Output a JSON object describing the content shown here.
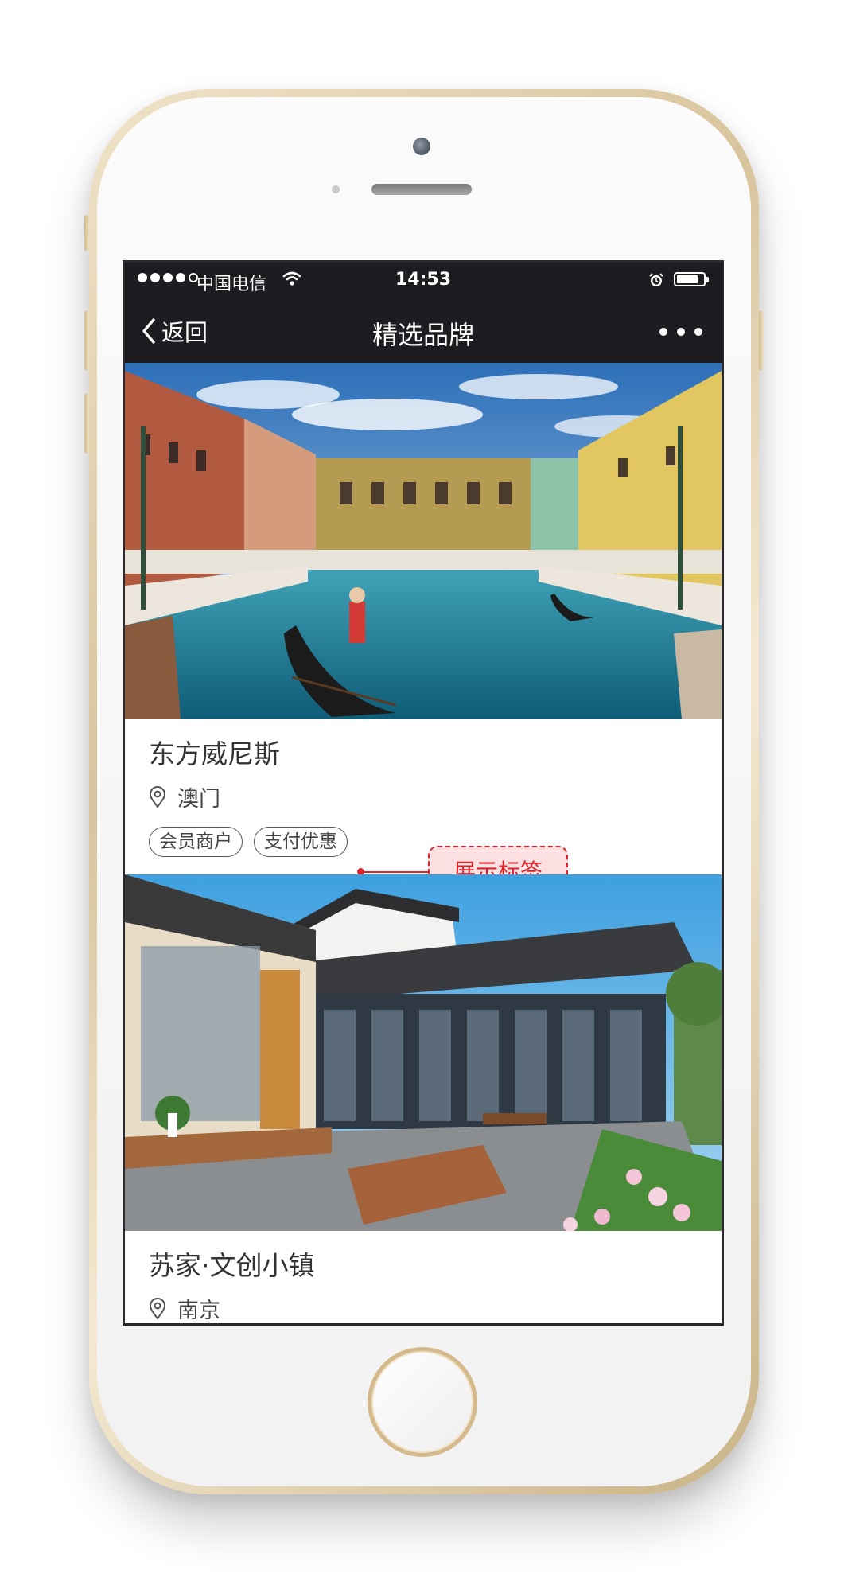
{
  "status_bar": {
    "carrier": "中国电信",
    "time": "14:53",
    "battery_level": 0.8
  },
  "nav": {
    "back_label": "返回",
    "title": "精选品牌"
  },
  "brands": [
    {
      "name": "东方威尼斯",
      "location": "澳门",
      "tags": [
        "会员商户",
        "支付优惠"
      ]
    },
    {
      "name": "苏家·文创小镇",
      "location": "南京",
      "tags": []
    }
  ],
  "annotation": {
    "label": "展示标签"
  },
  "colors": {
    "bar_background": "#1d1c21",
    "annotation_red": "#e0232a",
    "annotation_fill": "#fde1e2",
    "phone_gold": "#d8c49c"
  },
  "icons": {
    "back": "chevron-left-icon",
    "more": "more-dots-icon",
    "location": "location-pin-icon",
    "wifi": "wifi-icon",
    "alarm": "alarm-icon",
    "battery": "battery-icon"
  }
}
